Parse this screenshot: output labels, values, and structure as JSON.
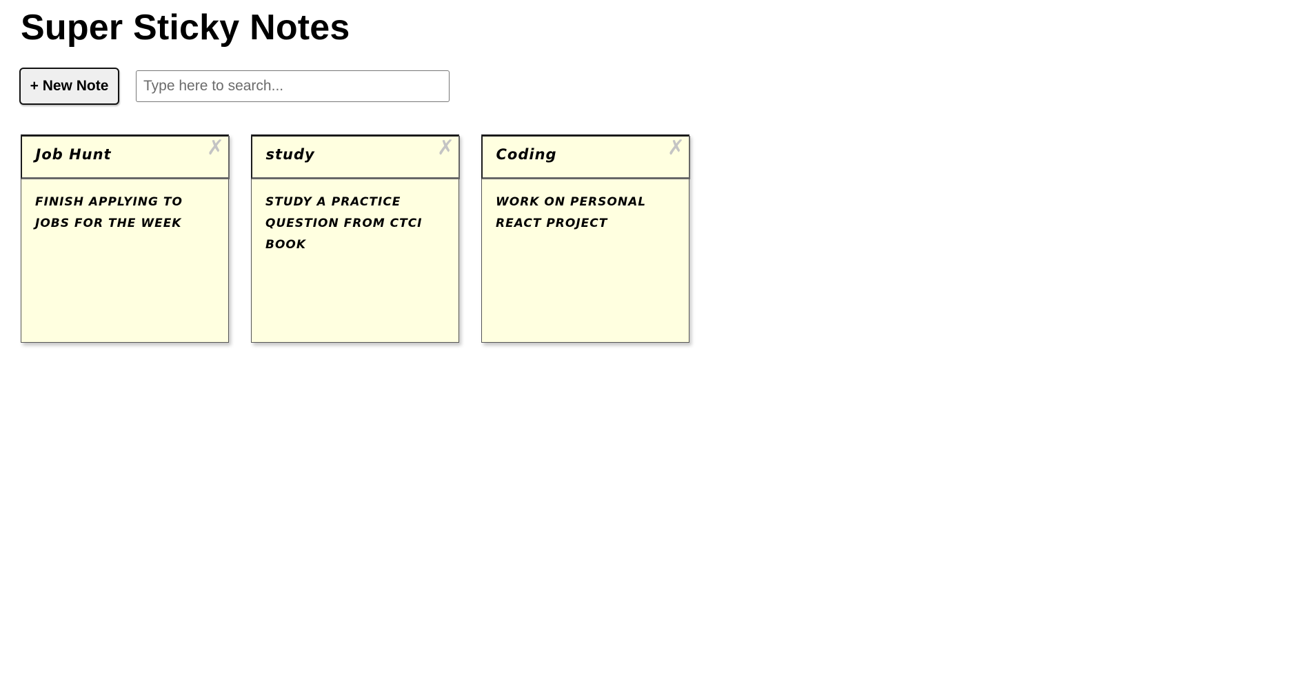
{
  "app": {
    "title": "Super Sticky Notes"
  },
  "toolbar": {
    "new_note_label": "+ New Note",
    "search_placeholder": "Type here to search...",
    "search_value": ""
  },
  "notes": [
    {
      "title": "Job Hunt",
      "description": "finish applying to jobs for the week",
      "delete_icon": "close-icon",
      "delete_glyph": "✗"
    },
    {
      "title": "study",
      "description": "study a practice question from CTCI book",
      "delete_icon": "close-icon",
      "delete_glyph": "✗"
    },
    {
      "title": "Coding",
      "description": "work on personal react project",
      "delete_icon": "close-icon",
      "delete_glyph": "✗"
    }
  ],
  "colors": {
    "note_background": "#ffffe0",
    "delete_icon": "#c4c4c4",
    "button_background": "#efefef"
  }
}
